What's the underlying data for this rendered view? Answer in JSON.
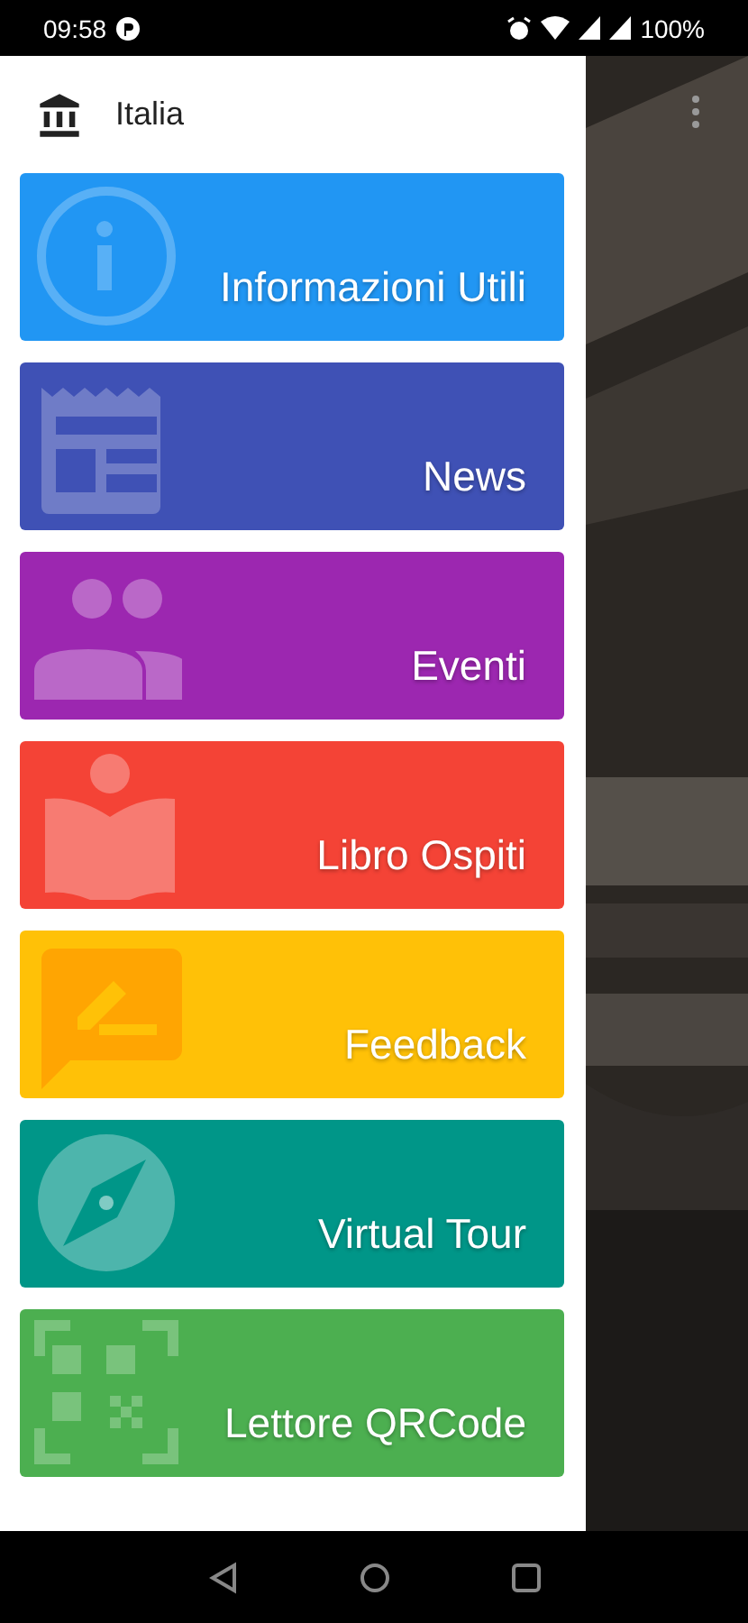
{
  "status_bar": {
    "time": "09:58",
    "battery": "100%"
  },
  "drawer": {
    "title": "Italia",
    "tiles": [
      {
        "label": "Informazioni Utili",
        "kind": "info",
        "color": "#2196f3"
      },
      {
        "label": "News",
        "kind": "news",
        "color": "#3f51b5"
      },
      {
        "label": "Eventi",
        "kind": "people",
        "color": "#9c27b0"
      },
      {
        "label": "Libro Ospiti",
        "kind": "reader",
        "color": "#f44336"
      },
      {
        "label": "Feedback",
        "kind": "feedback",
        "color": "#ffc107"
      },
      {
        "label": "Virtual Tour",
        "kind": "compass",
        "color": "#009688"
      },
      {
        "label": "Lettore QRCode",
        "kind": "qr",
        "color": "#4caf50"
      }
    ]
  }
}
